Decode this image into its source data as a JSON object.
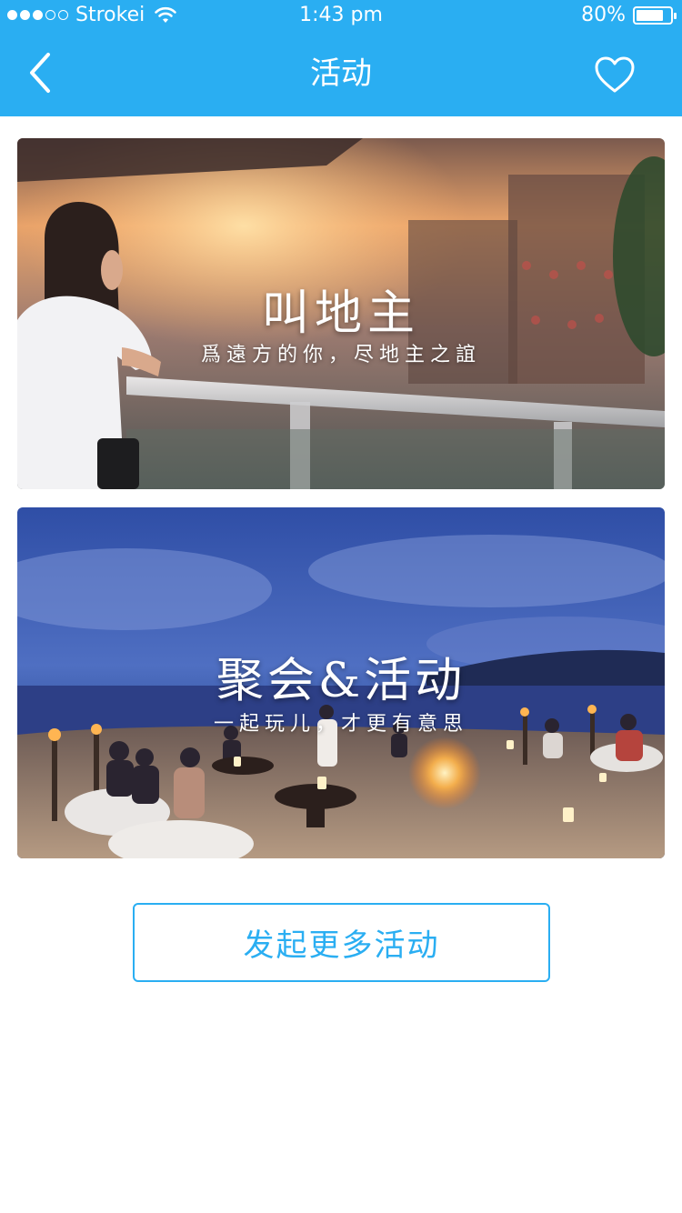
{
  "status_bar": {
    "carrier": "Strokei",
    "time": "1:43 pm",
    "battery": "80%",
    "battery_level": 0.8,
    "signal_strength": 3,
    "signal_max": 5
  },
  "nav": {
    "title": "活动",
    "back_icon": "chevron-left-icon",
    "favorite_icon": "heart-outline-icon"
  },
  "cards": [
    {
      "title": "叫地主",
      "subtitle": "爲遠方的你，尽地主之誼"
    },
    {
      "title": "聚会&活动",
      "subtitle": "一起玩儿，才更有意思"
    }
  ],
  "action": {
    "label": "发起更多活动"
  },
  "colors": {
    "primary": "#2aaef2",
    "background": "#ffffff"
  }
}
